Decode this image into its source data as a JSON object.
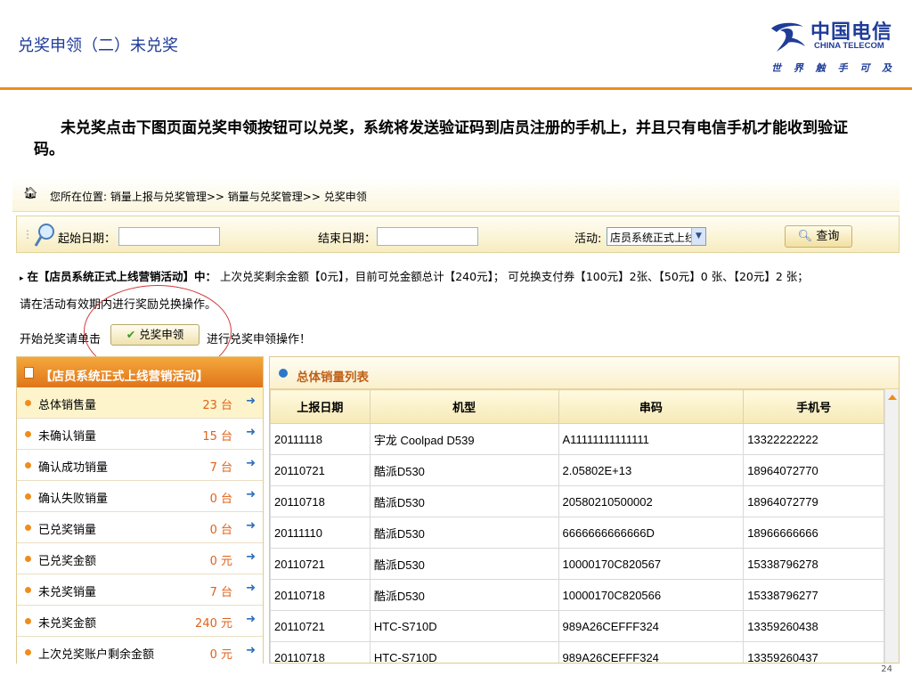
{
  "slide": {
    "title": "兑奖申领（二）未兑奖",
    "logo": {
      "cn_name": "中国电信",
      "en_name": "CHINA TELECOM",
      "slogan": "世 界 触 手 可 及"
    },
    "intro": "未兑奖点击下图页面兑奖申领按钮可以兑奖，系统将发送验证码到店员注册的手机上，并且只有电信手机才能收到验证码。",
    "page_number": "24"
  },
  "breadcrumb": {
    "icon": "home-icon",
    "text": "您所在位置: 销量上报与兑奖管理>> 销量与兑奖管理>> 兑奖申领"
  },
  "search": {
    "start_label": "起始日期：",
    "start_value": "",
    "end_label": "结束日期：",
    "end_value": "",
    "activity_label": "活动:",
    "activity_value": "店员系统正式上线",
    "query_label": "查询"
  },
  "info": {
    "prefix": "在【店员系统正式上线营销活动】中：",
    "text": "上次兑奖剩余金额【0元】，目前可兑金额总计【240元】；  可兑换支付券【100元】2张、【50元】0 张、【20元】2 张；",
    "note": "请在活动有效期内进行奖励兑换操作。",
    "start_text": "开始兑奖请单击",
    "button_label": "兑奖申领",
    "after_text": "进行兑奖申领操作！"
  },
  "left_panel": {
    "title": "【店员系统正式上线营销活动】",
    "items": [
      {
        "name": "总体销售量",
        "value": "23 台"
      },
      {
        "name": "未确认销量",
        "value": "15 台"
      },
      {
        "name": "确认成功销量",
        "value": "7 台"
      },
      {
        "name": "确认失败销量",
        "value": "0 台"
      },
      {
        "name": "已兑奖销量",
        "value": "0 台"
      },
      {
        "name": "已兑奖金额",
        "value": "0 元"
      },
      {
        "name": "未兑奖销量",
        "value": "7 台"
      },
      {
        "name": "未兑奖金额",
        "value": "240 元"
      },
      {
        "name": "上次兑奖账户剩余金额",
        "value": "0 元"
      }
    ]
  },
  "right_panel": {
    "title": "总体销量列表",
    "columns": [
      "上报日期",
      "机型",
      "串码",
      "手机号"
    ],
    "rows": [
      [
        "20111118",
        "宇龙 Coolpad D539",
        "A11111111111111",
        "13322222222"
      ],
      [
        "20110721",
        "酷派D530",
        "2.05802E+13",
        "18964072770"
      ],
      [
        "20110718",
        "酷派D530",
        "20580210500002",
        "18964072779"
      ],
      [
        "20111110",
        "酷派D530",
        "6666666666666D",
        "18966666666"
      ],
      [
        "20110721",
        "酷派D530",
        "10000170C820567",
        "15338796278"
      ],
      [
        "20110718",
        "酷派D530",
        "10000170C820566",
        "15338796277"
      ],
      [
        "20110721",
        "HTC-S710D",
        "989A26CEFFF324",
        "13359260438"
      ],
      [
        "20110718",
        "HTC-S710D",
        "989A26CEFFF324",
        "13359260437"
      ]
    ]
  },
  "colors": {
    "title_blue": "#1f3c99",
    "accent_orange": "#f08c1c",
    "value_orange": "#e0621a",
    "highlight_red": "#d23838"
  }
}
